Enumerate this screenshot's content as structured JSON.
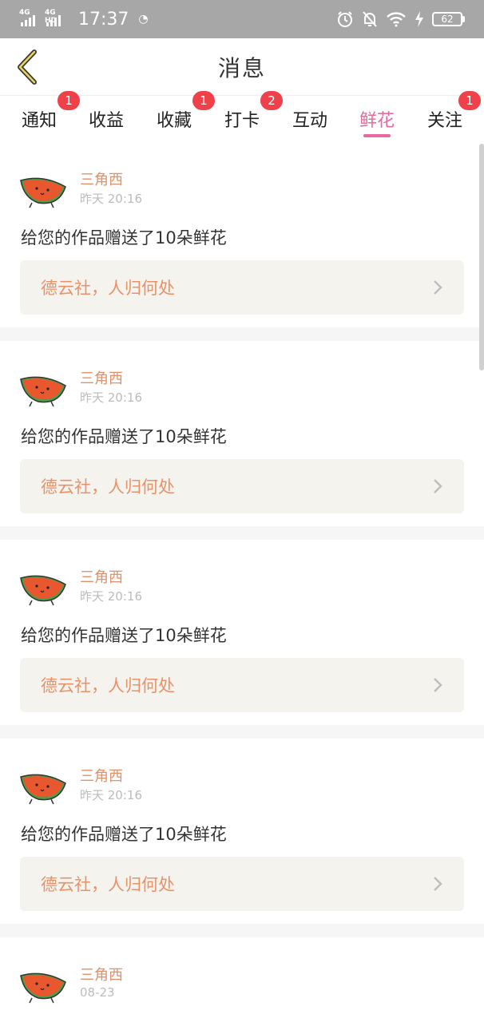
{
  "status_bar": {
    "net1": "4G",
    "net2": "4G HD",
    "time": "17:37",
    "extra": "◔",
    "battery": "62"
  },
  "header": {
    "title": "消息"
  },
  "tabs": [
    {
      "label": "通知",
      "badge": "1"
    },
    {
      "label": "收益",
      "badge": ""
    },
    {
      "label": "收藏",
      "badge": "1"
    },
    {
      "label": "打卡",
      "badge": "2"
    },
    {
      "label": "互动",
      "badge": ""
    },
    {
      "label": "鲜花",
      "badge": "",
      "active": true
    },
    {
      "label": "关注",
      "badge": "1"
    }
  ],
  "messages": [
    {
      "sender": "三角西",
      "time": "昨天 20:16",
      "content": "给您的作品赠送了10朵鲜花",
      "ref": "德云社，人归何处"
    },
    {
      "sender": "三角西",
      "time": "昨天 20:16",
      "content": "给您的作品赠送了10朵鲜花",
      "ref": "德云社，人归何处"
    },
    {
      "sender": "三角西",
      "time": "昨天 20:16",
      "content": "给您的作品赠送了10朵鲜花",
      "ref": "德云社，人归何处"
    },
    {
      "sender": "三角西",
      "time": "昨天 20:16",
      "content": "给您的作品赠送了10朵鲜花",
      "ref": "德云社，人归何处"
    },
    {
      "sender": "三角西",
      "time": "08-23",
      "content": "",
      "ref": ""
    }
  ],
  "colors": {
    "accent": "#e66aa0",
    "badge": "#f0404a",
    "sender": "#e0906a",
    "ref_bg": "#f4f3ee"
  }
}
